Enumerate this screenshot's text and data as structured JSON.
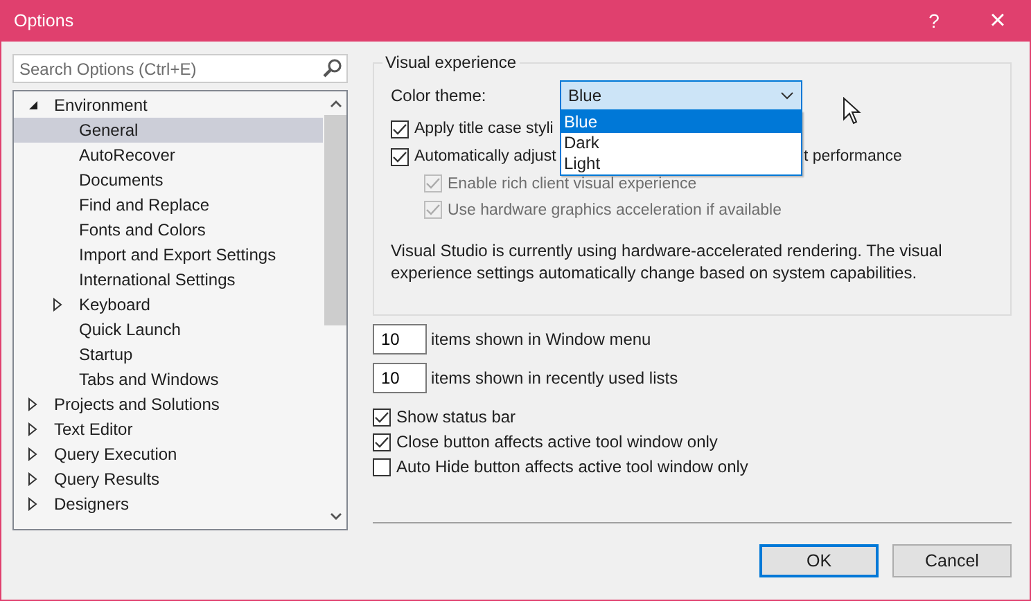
{
  "window": {
    "title": "Options",
    "help": "?",
    "close": "×"
  },
  "search": {
    "placeholder": "Search Options (Ctrl+E)"
  },
  "tree": [
    {
      "label": "Environment",
      "expanded": true,
      "selected": false,
      "children": [
        {
          "label": "General",
          "selected": true
        },
        {
          "label": "AutoRecover",
          "selected": false
        },
        {
          "label": "Documents",
          "selected": false
        },
        {
          "label": "Find and Replace",
          "selected": false
        },
        {
          "label": "Fonts and Colors",
          "selected": false
        },
        {
          "label": "Import and Export Settings",
          "selected": false
        },
        {
          "label": "International Settings",
          "selected": false
        },
        {
          "label": "Keyboard",
          "expanded": false,
          "selected": false
        },
        {
          "label": "Quick Launch",
          "selected": false
        },
        {
          "label": "Startup",
          "selected": false
        },
        {
          "label": "Tabs and Windows",
          "selected": false
        }
      ]
    },
    {
      "label": "Projects and Solutions",
      "expanded": false,
      "selected": false
    },
    {
      "label": "Text Editor",
      "expanded": false,
      "selected": false
    },
    {
      "label": "Query Execution",
      "expanded": false,
      "selected": false
    },
    {
      "label": "Query Results",
      "expanded": false,
      "selected": false
    },
    {
      "label": "Designers",
      "expanded": false,
      "selected": false
    }
  ],
  "visual_experience": {
    "legend": "Visual experience",
    "color_theme": {
      "label": "Color theme:",
      "value": "Blue",
      "open": true,
      "options": [
        {
          "label": "Blue",
          "selected": true
        },
        {
          "label": "Dark",
          "selected": false
        },
        {
          "label": "Light",
          "selected": false
        }
      ]
    },
    "checkboxes": [
      {
        "label": "Apply title case styli",
        "checked": true,
        "disabled": false
      },
      {
        "label": "Automatically adjust",
        "label_tail": "t performance",
        "checked": true,
        "disabled": false,
        "children": [
          {
            "label": "Enable rich client visual experience",
            "checked": true,
            "disabled": true
          },
          {
            "label": "Use hardware graphics acceleration if available",
            "checked": true,
            "disabled": true
          }
        ]
      }
    ],
    "note": "Visual Studio is currently using hardware-accelerated rendering. The visual experience settings automatically change based on system capabilities."
  },
  "counts": [
    {
      "value": "10",
      "label": "items shown in Window menu"
    },
    {
      "value": "10",
      "label": "items shown in recently used lists"
    }
  ],
  "options": [
    {
      "label": "Show status bar",
      "checked": true
    },
    {
      "label": "Close button affects active tool window only",
      "checked": true
    },
    {
      "label": "Auto Hide button affects active tool window only",
      "checked": false
    }
  ],
  "buttons": [
    {
      "label": "OK",
      "default": true
    },
    {
      "label": "Cancel",
      "default": false
    }
  ]
}
